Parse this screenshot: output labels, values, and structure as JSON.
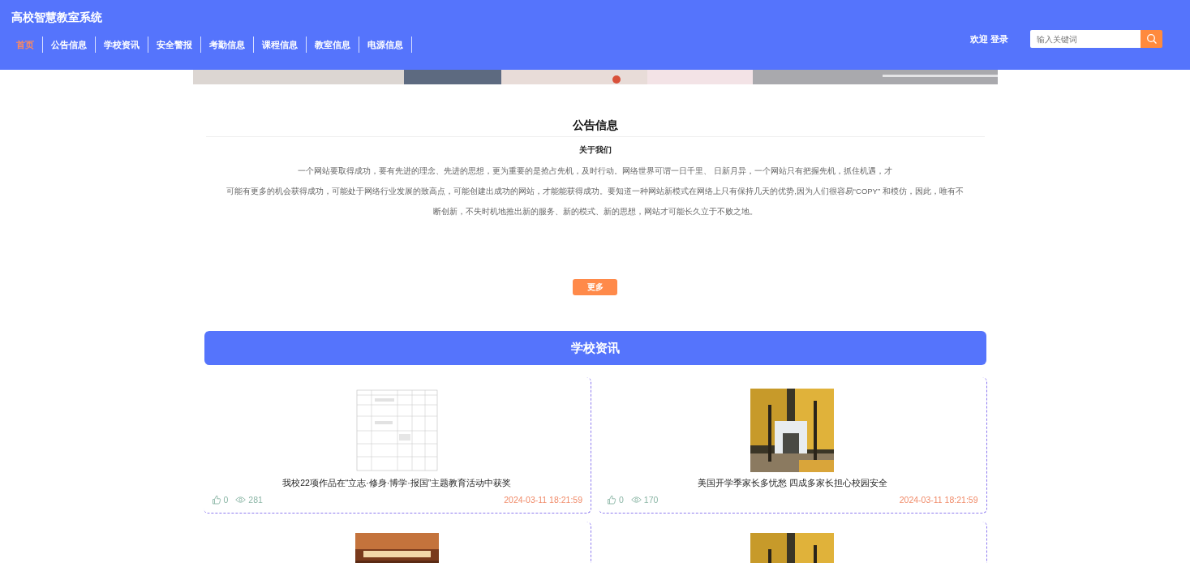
{
  "site_title": "高校智慧教室系统",
  "nav": [
    {
      "label": "首页",
      "selected": true
    },
    {
      "label": "公告信息",
      "selected": false
    },
    {
      "label": "学校资讯",
      "selected": false
    },
    {
      "label": "安全警报",
      "selected": false
    },
    {
      "label": "考勤信息",
      "selected": false
    },
    {
      "label": "课程信息",
      "selected": false
    },
    {
      "label": "教室信息",
      "selected": false
    },
    {
      "label": "电源信息",
      "selected": false
    }
  ],
  "user": {
    "welcome": "欢迎",
    "login": "登录"
  },
  "search": {
    "placeholder": "输入关键词"
  },
  "notice": {
    "title": "公告信息",
    "subtitle": "关于我们",
    "lines": [
      "一个网站要取得成功，要有先进的理念、先进的思想，更为重要的是抢占先机，及时行动。网络世界可谓一日千里、 日新月异，一个网站只有把握先机，抓住机遇，才",
      "可能有更多的机会获得成功，可能处于网络行业发展的致高点，可能创建出成功的网站，才能能获得成功。要知道一种网站新模式在网络上只有保持几天的优势,因为人们很容易“COPY” 和模仿，因此，唯有不",
      "断创新，不失时机地推出新的服务、新的模式、新的思想，网站才可能长久立于不败之地。"
    ],
    "more": "更多"
  },
  "news": {
    "title": "学校资讯",
    "items": [
      {
        "kind": "article",
        "title": "我校22项作品在“立志·修身·博学·报国”主题教育活动中获奖",
        "likes": "0",
        "views": "281",
        "date": "2024-03-11 18:21:59"
      },
      {
        "kind": "article",
        "title": "美国开学季家长多忧愁 四成多家长担心校园安全",
        "likes": "0",
        "views": "170",
        "date": "2024-03-11 18:21:59"
      },
      {
        "kind": "picture"
      },
      {
        "kind": "picture"
      }
    ]
  }
}
